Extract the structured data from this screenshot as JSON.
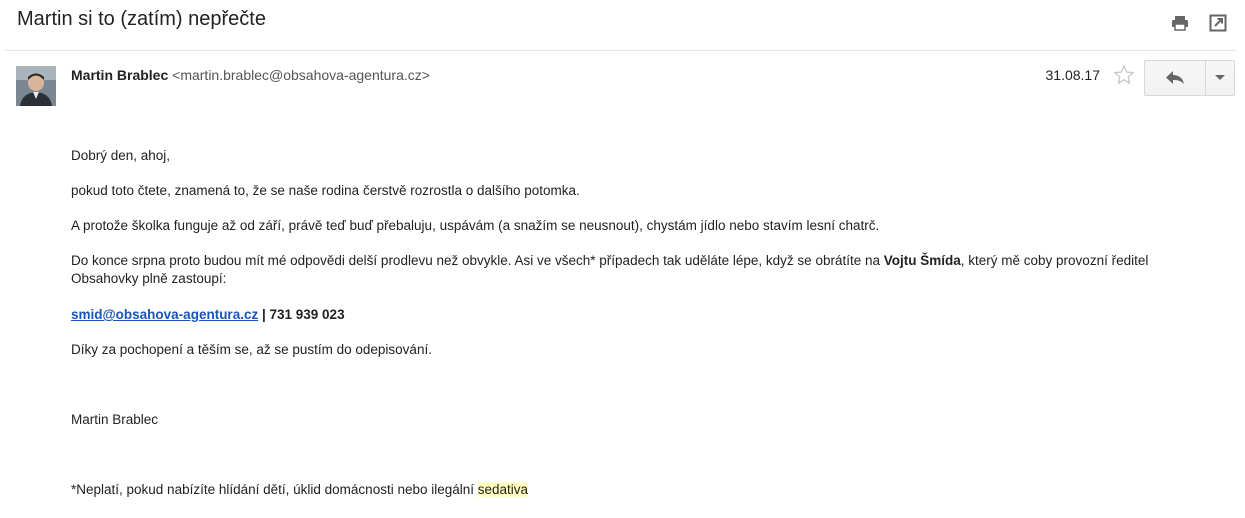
{
  "header": {
    "subject": "Martin si to (zatím) nepřečte",
    "print_icon": "printer-icon",
    "popout_icon": "open-in-new-window-icon"
  },
  "message": {
    "sender_name": "Martin Brablec",
    "sender_email": "<martin.brablec@obsahova-agentura.cz>",
    "date": "31.08.17",
    "star_icon": "star-icon",
    "reply_icon": "reply-icon",
    "more_icon": "dropdown-arrow-icon"
  },
  "body": {
    "greeting": "Dobrý den, ahoj,",
    "p1": "pokud toto čtete, znamená to, že se naše rodina čerstvě rozrostla o dalšího potomka.",
    "p2": "A protože školka funguje až od září, právě teď buď přebaluju, uspávám (a snažím se neusnout), chystám jídlo nebo stavím lesní chatrč.",
    "p3_pre": "Do konce srpna proto budou mít mé odpovědi delší prodlevu než obvykle. Asi ve všech* případech tak uděláte lépe, když se obrátíte na ",
    "p3_bold": "Vojtu Šmída",
    "p3_post": ", který mě coby provozní ředitel Obsahovky plně zastoupí:",
    "contact_email": "smid@obsahova-agentura.cz",
    "contact_phone": " | 731 939 023",
    "thanks": "Díky za pochopení a těším se, až se pustím do odepisování.",
    "signature": "Martin Brablec",
    "footnote_pre": "*Neplatí, pokud nabízíte hlídání dětí, úklid domácnosti nebo ilegální ",
    "footnote_hl": "sedativa"
  }
}
